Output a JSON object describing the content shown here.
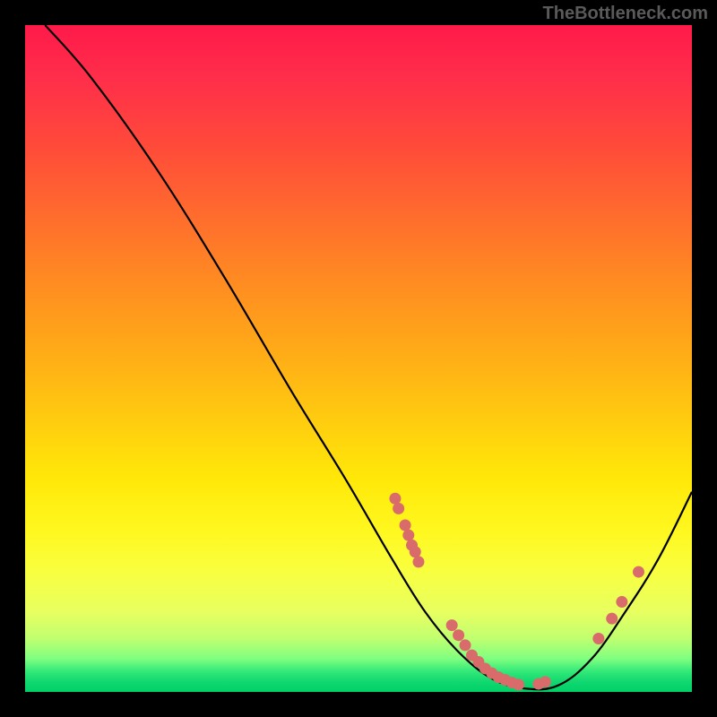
{
  "watermark": "TheBottleneck.com",
  "chart_data": {
    "type": "line",
    "title": "",
    "xlabel": "",
    "ylabel": "",
    "xlim": [
      0,
      100
    ],
    "ylim": [
      0,
      100
    ],
    "curve": [
      {
        "x": 3,
        "y": 100
      },
      {
        "x": 10,
        "y": 92
      },
      {
        "x": 20,
        "y": 78
      },
      {
        "x": 30,
        "y": 62
      },
      {
        "x": 40,
        "y": 45
      },
      {
        "x": 48,
        "y": 32
      },
      {
        "x": 55,
        "y": 20
      },
      {
        "x": 60,
        "y": 12
      },
      {
        "x": 65,
        "y": 6
      },
      {
        "x": 70,
        "y": 2
      },
      {
        "x": 75,
        "y": 0.5
      },
      {
        "x": 80,
        "y": 1
      },
      {
        "x": 85,
        "y": 5
      },
      {
        "x": 90,
        "y": 12
      },
      {
        "x": 95,
        "y": 20
      },
      {
        "x": 100,
        "y": 30
      }
    ],
    "points": [
      {
        "x": 55.5,
        "y": 29
      },
      {
        "x": 56,
        "y": 27.5
      },
      {
        "x": 57,
        "y": 25
      },
      {
        "x": 57.5,
        "y": 23.5
      },
      {
        "x": 58,
        "y": 22
      },
      {
        "x": 58.5,
        "y": 21
      },
      {
        "x": 59,
        "y": 19.5
      },
      {
        "x": 64,
        "y": 10
      },
      {
        "x": 65,
        "y": 8.5
      },
      {
        "x": 66,
        "y": 7
      },
      {
        "x": 67,
        "y": 5.5
      },
      {
        "x": 68,
        "y": 4.5
      },
      {
        "x": 69,
        "y": 3.5
      },
      {
        "x": 70,
        "y": 2.8
      },
      {
        "x": 71,
        "y": 2.2
      },
      {
        "x": 72,
        "y": 1.8
      },
      {
        "x": 73,
        "y": 1.4
      },
      {
        "x": 74,
        "y": 1.1
      },
      {
        "x": 77,
        "y": 1.2
      },
      {
        "x": 78,
        "y": 1.5
      },
      {
        "x": 86,
        "y": 8
      },
      {
        "x": 88,
        "y": 11
      },
      {
        "x": 89.5,
        "y": 13.5
      },
      {
        "x": 92,
        "y": 18
      }
    ],
    "colors": {
      "curve": "#000000",
      "dots": "#d96b6b",
      "gradient_top": "#ff1a4a",
      "gradient_bottom": "#00d068"
    }
  }
}
